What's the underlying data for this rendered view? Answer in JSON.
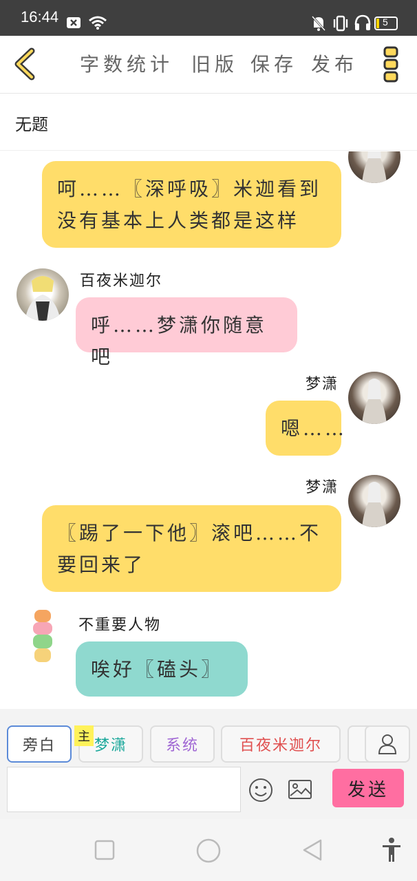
{
  "status_bar": {
    "time": "16:44",
    "battery": "5"
  },
  "header": {
    "menu": [
      "字数统计",
      "旧版",
      "保存",
      "发布"
    ]
  },
  "document_title": "无题",
  "messages": [
    {
      "side": "right",
      "text": "呵……〖深呼吸〗米迦看到没有基本上人类都是这样"
    },
    {
      "side": "left",
      "name": "百夜米迦尔",
      "text": "呼……梦潇你随意吧"
    },
    {
      "side": "right",
      "name": "梦潇",
      "text": "嗯……"
    },
    {
      "side": "right",
      "name": "梦潇",
      "text": "〖踢了一下他〗滚吧……不要回来了"
    },
    {
      "side": "left",
      "name": "不重要人物",
      "text": "唉好〖磕头〗"
    }
  ],
  "roles": {
    "items": [
      "旁白",
      "梦潇",
      "系统",
      "百夜米迦尔"
    ],
    "badge": "主"
  },
  "input": {
    "value": "",
    "send_label": "发送"
  },
  "colors": {
    "yellow_bubble": "#ffdd6a",
    "pink_bubble": "#ffcbd6",
    "teal_bubble": "#8fd9cf",
    "send_button": "#ff6ea1",
    "active_chip_border": "#5b8ad8"
  },
  "icons": {
    "back": "chevron-left-icon",
    "more": "more-vertical-icon",
    "emoji": "emoji-icon",
    "image": "image-icon",
    "person": "person-icon"
  }
}
